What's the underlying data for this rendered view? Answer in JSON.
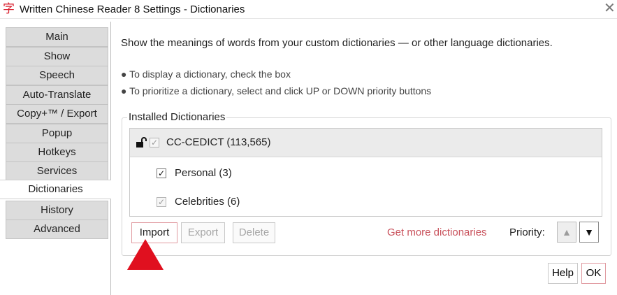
{
  "window": {
    "app_icon": "字",
    "title": "Written Chinese Reader 8 Settings - Dictionaries",
    "close_glyph": "✕"
  },
  "sidebar": {
    "items": [
      {
        "label": "Main"
      },
      {
        "label": "Show"
      },
      {
        "label": "Speech"
      },
      {
        "label": "Auto-Translate"
      },
      {
        "label": "Copy+™ / Export"
      },
      {
        "label": "Popup"
      },
      {
        "label": "Hotkeys"
      },
      {
        "label": "Services"
      },
      {
        "label": "Dictionaries",
        "active": true
      },
      {
        "label": "History"
      },
      {
        "label": "Advanced"
      }
    ]
  },
  "main": {
    "description": "Show the meanings of words from your custom dictionaries — or other language dictionaries.",
    "hint_display": "● To display a dictionary, check the box",
    "hint_priority": "● To prioritize a dictionary, select and click UP or DOWN priority buttons",
    "group_label": "Installed Dictionaries",
    "dictionaries": [
      {
        "name": "CC-CEDICT (113,565)",
        "checked": true,
        "locked": true,
        "selected": true
      },
      {
        "name": "Personal (3)",
        "checked": true,
        "locked": false,
        "selected": false
      },
      {
        "name": "Celebrities (6)",
        "checked": true,
        "locked": false,
        "selected": false
      }
    ],
    "buttons": {
      "import": "Import",
      "export": "Export",
      "delete": "Delete"
    },
    "get_more_link": "Get more dictionaries",
    "priority_label": "Priority:",
    "priority_up": "▲",
    "priority_down": "▼"
  },
  "footer": {
    "help": "Help",
    "ok": "OK"
  },
  "colors": {
    "accent_red": "#d81e2c",
    "link_red": "#c9525c",
    "annotation_arrow": "#e0101f"
  }
}
